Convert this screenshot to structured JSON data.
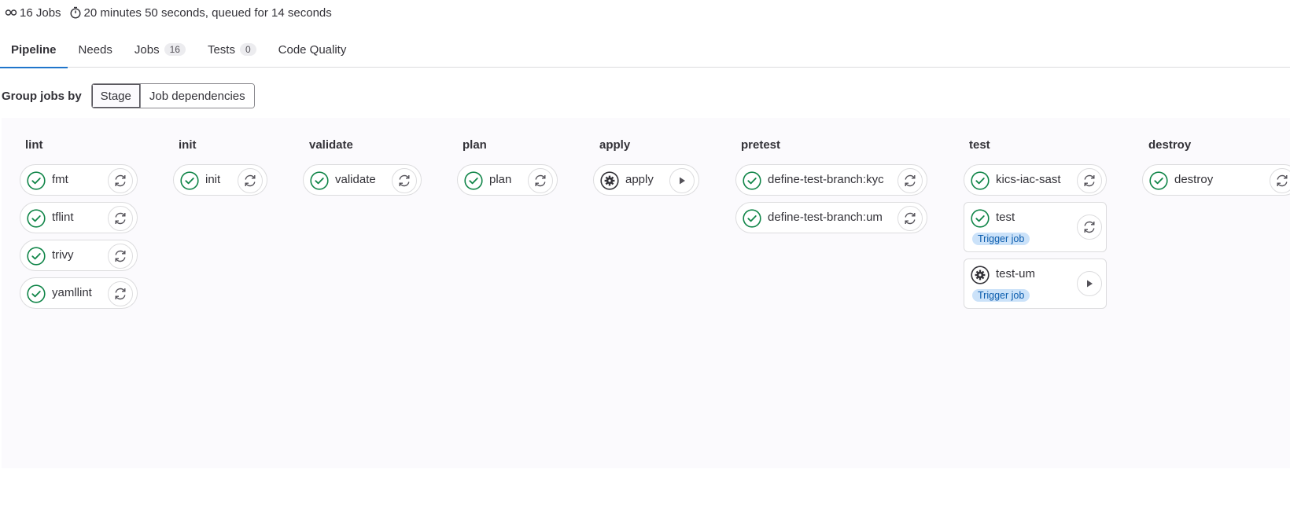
{
  "summary": {
    "jobs_text": "16 Jobs",
    "duration_text": "20 minutes 50 seconds, queued for 14 seconds"
  },
  "tabs": [
    {
      "label": "Pipeline",
      "active": true
    },
    {
      "label": "Needs"
    },
    {
      "label": "Jobs",
      "badge": "16"
    },
    {
      "label": "Tests",
      "badge": "0"
    },
    {
      "label": "Code Quality"
    }
  ],
  "group_by": {
    "label": "Group jobs by",
    "options": [
      "Stage",
      "Job dependencies"
    ],
    "selected": "Stage"
  },
  "colors": {
    "success": "#108548",
    "manual": "#333238",
    "tab_active": "#1f75cb",
    "trigger_badge_bg": "#cbe2f9",
    "trigger_badge_text": "#0b5cad"
  },
  "stages": [
    {
      "title": "lint",
      "jobs": [
        {
          "name": "fmt",
          "status": "success",
          "action": "retry-icon"
        },
        {
          "name": "tflint",
          "status": "success",
          "action": "retry-icon"
        },
        {
          "name": "trivy",
          "status": "success",
          "action": "retry-icon"
        },
        {
          "name": "yamllint",
          "status": "success",
          "action": "retry-icon"
        }
      ]
    },
    {
      "title": "init",
      "jobs": [
        {
          "name": "init",
          "status": "success",
          "action": "retry-icon"
        }
      ]
    },
    {
      "title": "validate",
      "jobs": [
        {
          "name": "validate",
          "status": "success",
          "action": "retry-icon"
        }
      ]
    },
    {
      "title": "plan",
      "jobs": [
        {
          "name": "plan",
          "status": "success",
          "action": "retry-icon"
        }
      ]
    },
    {
      "title": "apply",
      "jobs": [
        {
          "name": "apply",
          "status": "manual",
          "action": "play-icon"
        }
      ]
    },
    {
      "title": "pretest",
      "jobs": [
        {
          "name": "define-test-branch:kyc",
          "status": "success",
          "action": "retry-icon"
        },
        {
          "name": "define-test-branch:um",
          "status": "success",
          "action": "retry-icon"
        }
      ]
    },
    {
      "title": "test",
      "jobs": [
        {
          "name": "kics-iac-sast",
          "status": "success",
          "action": "retry-icon"
        },
        {
          "name": "test",
          "status": "success",
          "action": "retry-icon",
          "badge": "Trigger job"
        },
        {
          "name": "test-um",
          "status": "manual",
          "action": "play-icon",
          "badge": "Trigger job"
        }
      ]
    },
    {
      "title": "destroy",
      "jobs": [
        {
          "name": "destroy",
          "status": "success",
          "action": "retry-icon"
        }
      ]
    }
  ]
}
